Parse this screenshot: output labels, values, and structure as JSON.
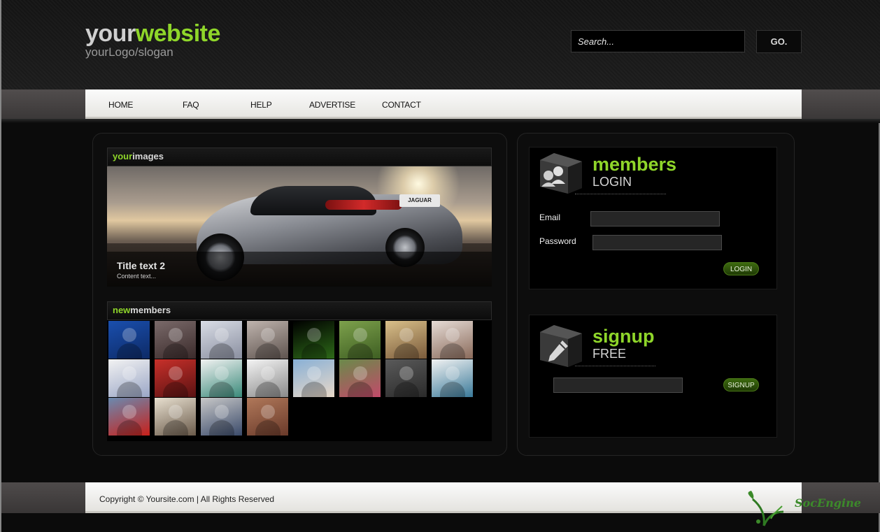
{
  "logo": {
    "main_a": "your",
    "main_b": "website",
    "slogan": "yourLogo/slogan"
  },
  "search": {
    "placeholder": "Search...",
    "button_label": "GO."
  },
  "nav": {
    "items": [
      "HOME",
      "FAQ",
      "HELP",
      "ADVERTISE",
      "CONTACT"
    ]
  },
  "images_box": {
    "title_a": "your",
    "title_b": "images",
    "slide_title": "Title text 2",
    "slide_text": "Content text...",
    "plate": "JAGUAR"
  },
  "members_box": {
    "title_a": "new",
    "title_b": "members",
    "thumb_count": 20
  },
  "login_box": {
    "heading": "members",
    "subheading": "LOGIN",
    "email_label": "Email",
    "password_label": "Password",
    "login_button": "LOGIN"
  },
  "signup_box": {
    "heading": "signup",
    "subheading": "FREE",
    "signup_button": "SIGNUP"
  },
  "footer": {
    "copyright": "Copyright © Yoursite.com | All Rights Reserved"
  },
  "watermark": "SocEngine",
  "colors": {
    "accent": "#8fd62a",
    "background": "#0b0b0b",
    "button_green": "#2e5208"
  },
  "icons": [
    "members-cube-icon",
    "signup-pencil-cube-icon",
    "socengine-logo-icon"
  ]
}
